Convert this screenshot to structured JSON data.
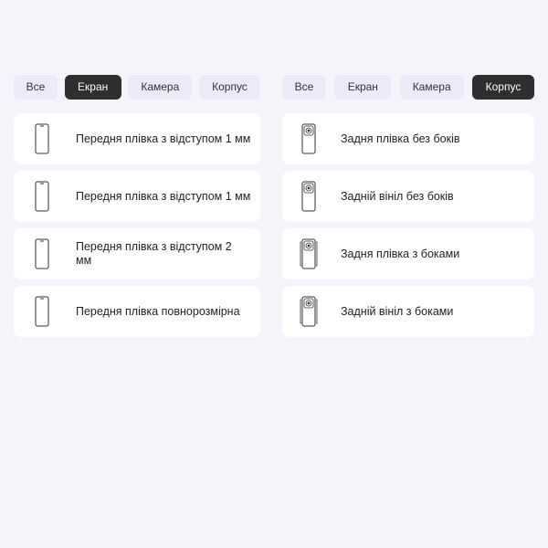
{
  "left_panel": {
    "tabs": [
      {
        "label": "Все",
        "active": false
      },
      {
        "label": "Екран",
        "active": true
      },
      {
        "label": "Камера",
        "active": false
      },
      {
        "label": "Корпус",
        "active": false
      }
    ],
    "items": [
      {
        "label": "Передня плівка з відступом 1 мм",
        "icon": "phone-front-icon"
      },
      {
        "label": "Передня плівка з відступом 1 мм",
        "icon": "phone-front-icon"
      },
      {
        "label": "Передня плівка з відступом 2 мм",
        "icon": "phone-front-icon"
      },
      {
        "label": "Передня плівка повнорозмірна",
        "icon": "phone-front-icon"
      }
    ]
  },
  "right_panel": {
    "tabs": [
      {
        "label": "Все",
        "active": false
      },
      {
        "label": "Екран",
        "active": false
      },
      {
        "label": "Камера",
        "active": false
      },
      {
        "label": "Корпус",
        "active": true
      }
    ],
    "items": [
      {
        "label": "Задня плівка без боків",
        "icon": "phone-back-icon"
      },
      {
        "label": "Задній вініл без боків",
        "icon": "phone-back-icon"
      },
      {
        "label": "Задня плівка з боками",
        "icon": "phone-back-sides-icon"
      },
      {
        "label": "Задній вініл з боками",
        "icon": "phone-back-sides-icon"
      }
    ]
  },
  "colors": {
    "background": "#f5f4fb",
    "tab_inactive": "#ece9f8",
    "tab_active": "#2e2e2e",
    "card": "#ffffff"
  }
}
